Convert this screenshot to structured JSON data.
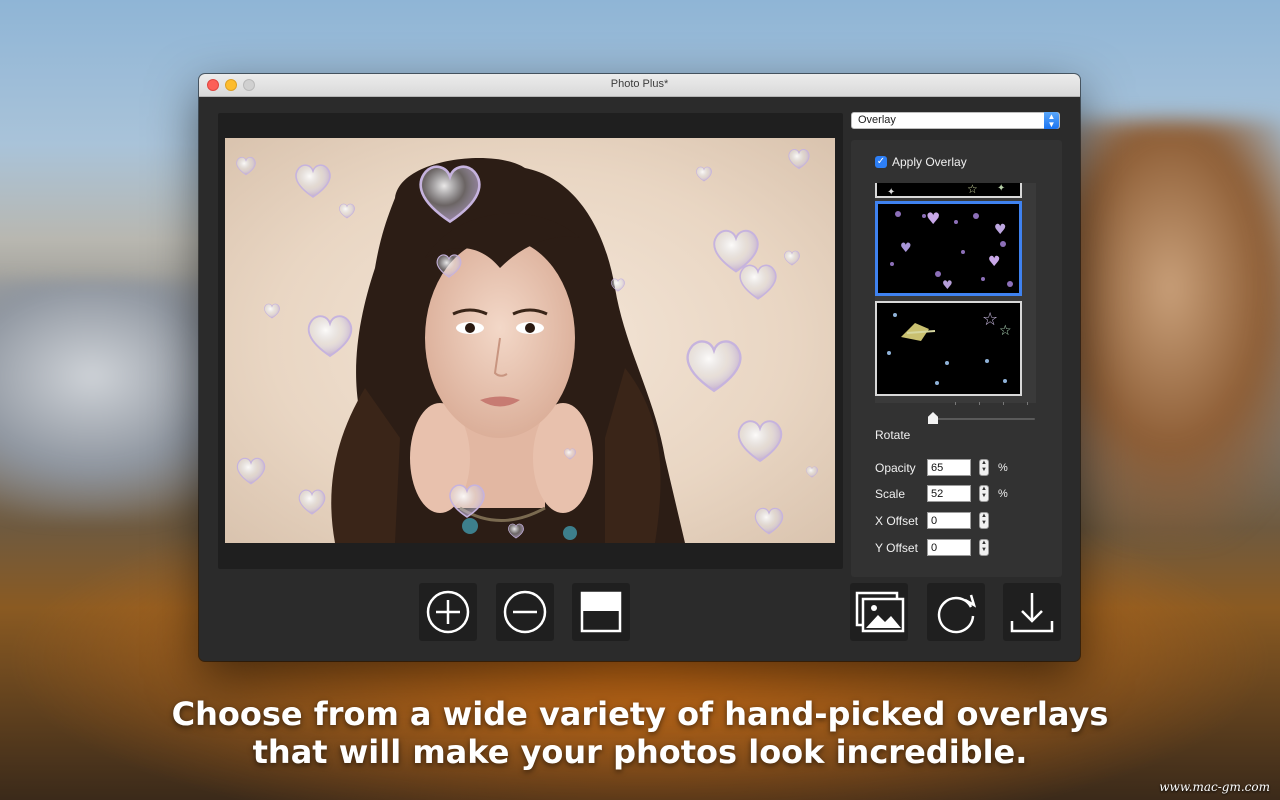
{
  "window": {
    "title": "Photo Plus*"
  },
  "sidebar": {
    "category_select": "Overlay",
    "apply_overlay": {
      "label": "Apply Overlay",
      "checked": true
    },
    "thumbnails": [
      {
        "name": "star-overlay-partial",
        "selected": false
      },
      {
        "name": "hearts-bubbles-overlay",
        "selected": true
      },
      {
        "name": "stars-sparkle-overlay",
        "selected": false
      }
    ],
    "rotate_label": "Rotate",
    "rotate_value": 0,
    "fields": [
      {
        "label": "Opacity",
        "value": "65",
        "unit": "%"
      },
      {
        "label": "Scale",
        "value": "52",
        "unit": "%"
      },
      {
        "label": "X Offset",
        "value": "0",
        "unit": ""
      },
      {
        "label": "Y Offset",
        "value": "0",
        "unit": ""
      }
    ]
  },
  "toolbar": {
    "left": [
      {
        "name": "zoom-in-icon"
      },
      {
        "name": "zoom-out-icon"
      },
      {
        "name": "fit-frame-icon"
      }
    ],
    "right": [
      {
        "name": "image-gallery-icon"
      },
      {
        "name": "rotate-icon"
      },
      {
        "name": "download-icon"
      }
    ]
  },
  "caption": {
    "line1": "Choose from a wide variety of hand-picked overlays",
    "line2": "that will make your photos look incredible."
  },
  "watermark": "www.mac-gm.com",
  "colors": {
    "accent": "#2d7ff6",
    "window_bg": "#2b2b2b"
  }
}
